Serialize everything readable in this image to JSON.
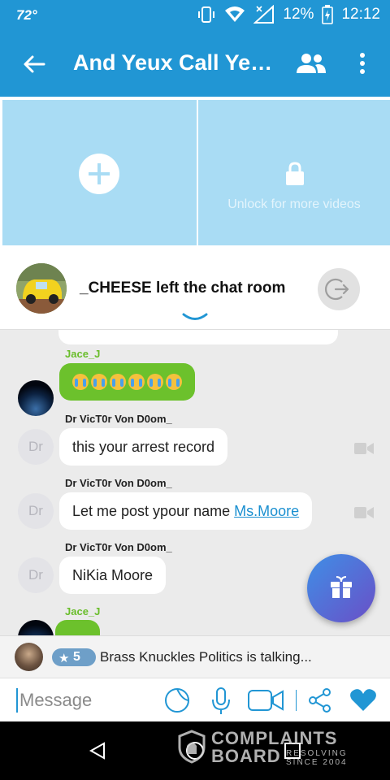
{
  "status_bar": {
    "temperature": "72°",
    "battery": "12%",
    "time": "12:12"
  },
  "header": {
    "title": "And Yeux Call Ye…"
  },
  "video_tiles": {
    "unlock_text": "Unlock for more videos"
  },
  "notification": {
    "text": "_CHEESE left the chat room"
  },
  "messages": [
    {
      "sender": "Jace_J",
      "kind": "emoji",
      "emoji_count": 6
    },
    {
      "sender": "Dr VicT0r Von D0om_",
      "avatar_text": "Dr",
      "text": "this your arrest record"
    },
    {
      "sender": "Dr VicT0r Von D0om_",
      "avatar_text": "Dr",
      "text": "Let me post ypour name ",
      "link": "Ms.Moore"
    },
    {
      "sender": "Dr VicT0r Von D0om_",
      "avatar_text": "Dr",
      "text": "NiKia Moore"
    },
    {
      "sender": "Jace_J",
      "kind": "partial"
    }
  ],
  "talking": {
    "level": "5",
    "text": "Brass Knuckles Politics is talking..."
  },
  "composer": {
    "placeholder": "Message"
  },
  "watermark": {
    "line1": "COMPLAINTS",
    "line2": "BOARD",
    "line3a": "RESOLVING",
    "line3b": "SINCE 2004"
  },
  "colors": {
    "primary": "#2196d4",
    "tile": "#a9dcf4",
    "green_bubble": "#6cc12c",
    "sender_green": "#69bd2a",
    "link": "#1a8fd0"
  }
}
